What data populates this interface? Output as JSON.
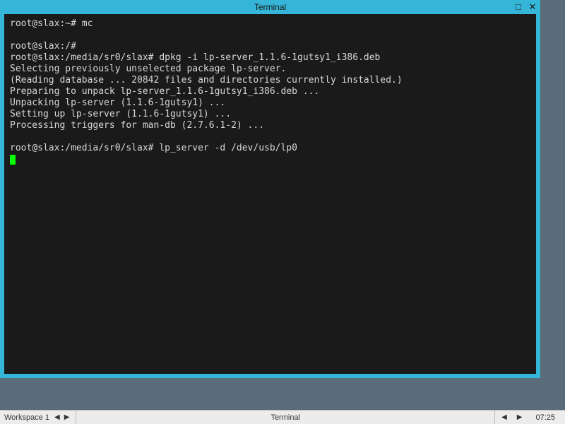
{
  "window": {
    "title": "Terminal"
  },
  "terminal": {
    "lines": [
      "root@slax:~# mc",
      "",
      "root@slax:/#",
      "root@slax:/media/sr0/slax# dpkg -i lp-server_1.1.6-1gutsy1_i386.deb",
      "Selecting previously unselected package lp-server.",
      "(Reading database ... 20842 files and directories currently installed.)",
      "Preparing to unpack lp-server_1.1.6-1gutsy1_i386.deb ...",
      "Unpacking lp-server (1.1.6-1gutsy1) ...",
      "Setting up lp-server (1.1.6-1gutsy1) ...",
      "Processing triggers for man-db (2.7.6.1-2) ...",
      "",
      "root@slax:/media/sr0/slax# lp_server -d /dev/usb/lp0"
    ]
  },
  "taskbar": {
    "workspace": "Workspace 1",
    "active_app": "Terminal",
    "clock": "07:25"
  }
}
